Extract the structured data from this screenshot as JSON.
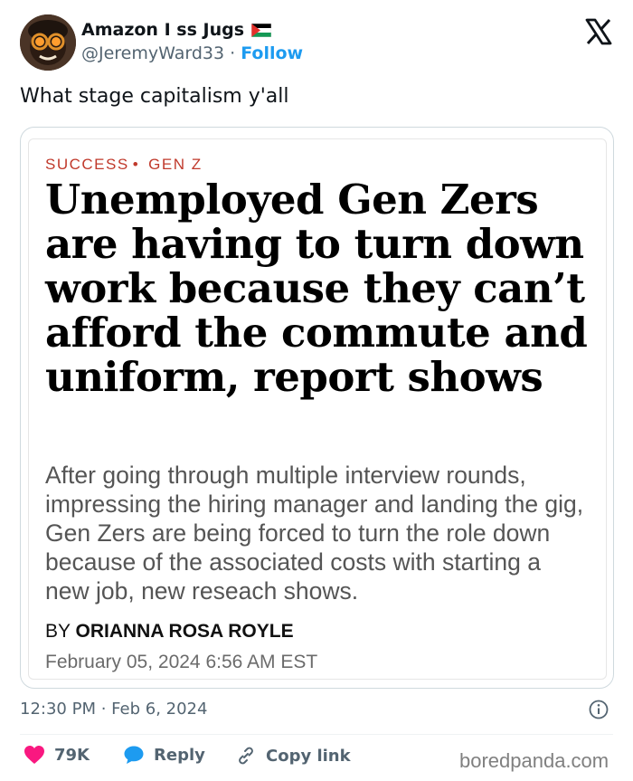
{
  "author": {
    "display_name": "Amazon I  ss Jugs",
    "handle": "@JeremyWard33",
    "separator": "·",
    "follow_label": "Follow"
  },
  "tweet": {
    "text": "What stage capitalism y'all"
  },
  "article": {
    "category_1": "SUCCESS",
    "category_2": "GEN Z",
    "headline": "Unemployed Gen Zers are having to turn down work because they can’t afford the commute and uniform, report shows",
    "dek": "After going through multiple interview rounds, impressing the hiring manager and landing the gig, Gen Zers are being forced to turn the role down because of the associated costs with starting a new job, new reseach shows.",
    "byline_prefix": "BY",
    "author": "ORIANNA ROSA ROYLE",
    "date": "February 05, 2024 6:56 AM EST"
  },
  "meta": {
    "timestamp": "12:30 PM · Feb 6, 2024"
  },
  "actions": {
    "like_count": "79K",
    "reply_label": "Reply",
    "copy_label": "Copy link"
  },
  "watermark": "boredpanda.com",
  "colors": {
    "follow": "#1d9bf0",
    "like": "#f91880",
    "reply": "#1d9bf0",
    "category": "#c0392b"
  },
  "icons": [
    "x-logo-icon",
    "flag-icon",
    "heart-icon",
    "reply-bubble-icon",
    "link-icon",
    "info-icon"
  ]
}
